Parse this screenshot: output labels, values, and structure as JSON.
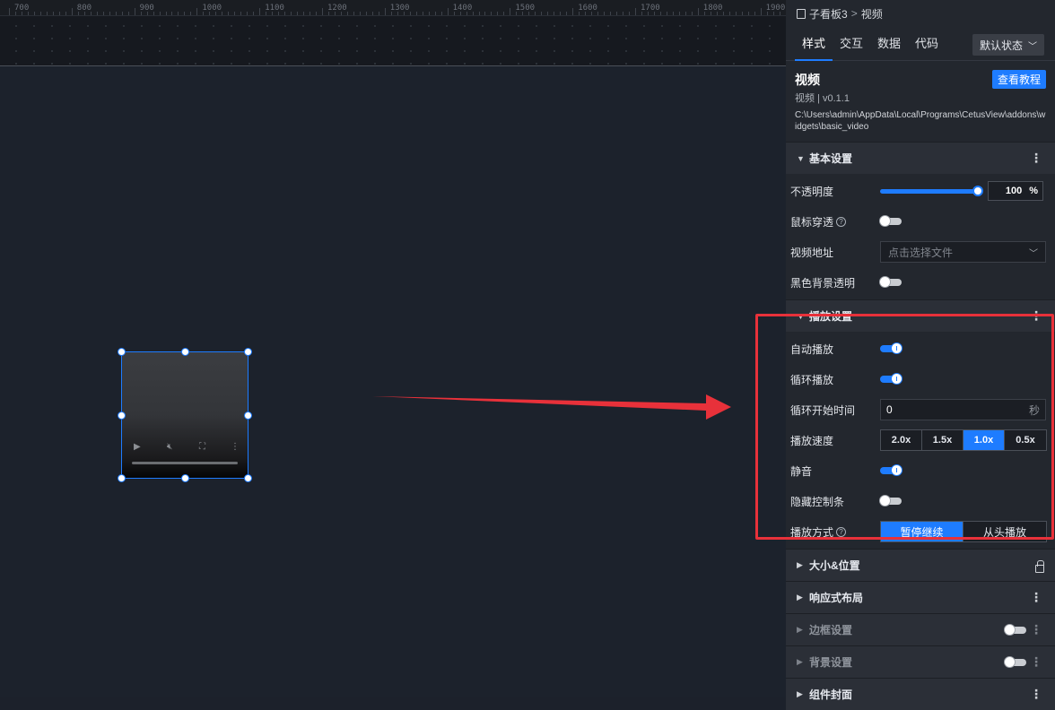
{
  "ruler": {
    "ticks": [
      "700",
      "800",
      "900",
      "1000",
      "1100",
      "1200",
      "1300",
      "1400",
      "1500",
      "1600",
      "1700",
      "1800",
      "1900"
    ]
  },
  "panel": {
    "breadcrumb": {
      "parent": "子看板3",
      "separator": ">",
      "current": "视频"
    },
    "tabs": [
      {
        "label": "样式",
        "active": true
      },
      {
        "label": "交互",
        "active": false
      },
      {
        "label": "数据",
        "active": false
      },
      {
        "label": "代码",
        "active": false
      }
    ],
    "state_select": {
      "value": "默认状态"
    },
    "widget": {
      "title": "视频",
      "tutorial_label": "查看教程",
      "version": "视频 | v0.1.1",
      "path": "C:\\Users\\admin\\AppData\\Local\\Programs\\CetusView\\addons\\widgets\\basic_video"
    },
    "sections": {
      "basic": {
        "title": "基本设置",
        "opacity_label": "不透明度",
        "opacity_value": "100",
        "opacity_unit": "%",
        "opacity_fraction": 1.0,
        "mouse_through_label": "鼠标穿透",
        "mouse_through_on": false,
        "video_url_label": "视频地址",
        "video_url_placeholder": "点击选择文件",
        "black_bg_label": "黑色背景透明",
        "black_bg_on": false
      },
      "playback": {
        "title": "播放设置",
        "autoplay_label": "自动播放",
        "autoplay_on": true,
        "loop_label": "循环播放",
        "loop_on": true,
        "loop_start_label": "循环开始时间",
        "loop_start_value": "0",
        "loop_start_unit": "秒",
        "speed_label": "播放速度",
        "speed_options": [
          "2.0x",
          "1.5x",
          "1.0x",
          "0.5x"
        ],
        "speed_selected": "1.0x",
        "mute_label": "静音",
        "mute_on": true,
        "hide_controls_label": "隐藏控制条",
        "hide_controls_on": false,
        "play_mode_label": "播放方式",
        "play_mode_options": [
          "暂停继续",
          "从头播放"
        ],
        "play_mode_selected": "暂停继续"
      },
      "size_position": {
        "title": "大小&位置"
      },
      "responsive": {
        "title": "响应式布局"
      },
      "border": {
        "title": "边框设置"
      },
      "background": {
        "title": "背景设置"
      },
      "cover": {
        "title": "组件封面"
      }
    }
  },
  "colors": {
    "accent": "#1e7cff",
    "highlight": "#e8313a",
    "panel_bg": "#23272e",
    "canvas_bg": "#1c222c"
  },
  "icons": [
    "board-icon",
    "chevron-down-icon",
    "help-icon",
    "more-icon",
    "lock-icon",
    "play-icon",
    "mute-icon",
    "fullscreen-icon"
  ]
}
